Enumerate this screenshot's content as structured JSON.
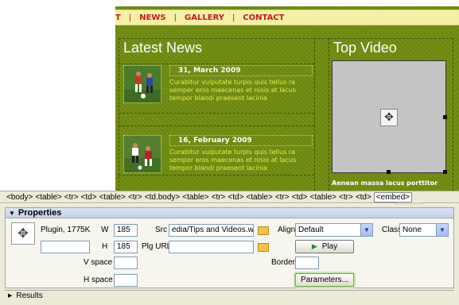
{
  "nav": {
    "items": [
      "T",
      "NEWS",
      "GALLERY",
      "CONTACT"
    ]
  },
  "latest_news": {
    "title": "Latest News",
    "items": [
      {
        "date": "31, March 2009",
        "excerpt": "Curabitur vulputate turpis quis tellus ra semper eros maecenas et nisio at lacus tempor blandi praesent lacinia"
      },
      {
        "date": "16, February 2009",
        "excerpt": "Curabitur vulputate turpis quis tellus ra semper eros maecenas et nisio at lacus tempor blandi praesent lacinia"
      }
    ]
  },
  "top_video": {
    "title": "Top Video",
    "caption": "Aenean massa lacus porttitor"
  },
  "tag_selector": {
    "tags": [
      "<body>",
      "<table>",
      "<tr>",
      "<td>",
      "<table>",
      "<tr>",
      "<td.body>",
      "<table>",
      "<tr>",
      "<td>",
      "<table>",
      "<tr>",
      "<td>",
      "<table>",
      "<tr>",
      "<td>"
    ],
    "selected_tag": "<embed>"
  },
  "properties": {
    "header": "Properties",
    "object_label": "Plugin, 1775K",
    "w_label": "W",
    "w_value": "185",
    "h_label": "H",
    "h_value": "185",
    "src_label": "Src",
    "src_value": "edia/Tips and Videos.wmv",
    "plg_url_label": "Plg URL",
    "plg_url_value": "",
    "align_label": "Align",
    "align_value": "Default",
    "class_label": "Class",
    "class_value": "None",
    "play_label": "Play",
    "v_space_label": "V space",
    "h_space_label": "H space",
    "border_label": "Border",
    "parameters_label": "Parameters..."
  },
  "results": {
    "label": "Results"
  },
  "icons": [
    "plugin-icon",
    "folder-icon",
    "play-icon",
    "dropdown-arrow-icon",
    "collapse-arrow-icon",
    "expand-arrow-icon"
  ]
}
